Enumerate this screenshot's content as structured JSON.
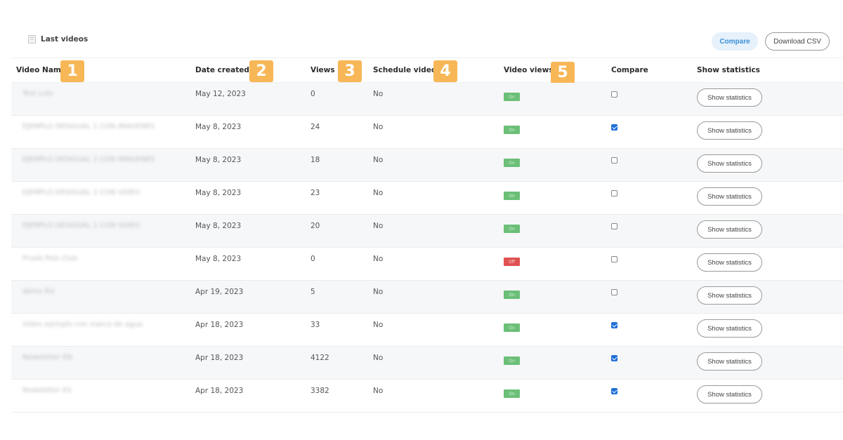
{
  "header": {
    "title": "Last videos",
    "title_icon": "calendar-icon",
    "compare_label": "Compare",
    "download_label": "Download CSV"
  },
  "columns": [
    {
      "label": "Video Name",
      "badge": "1"
    },
    {
      "label": "Date created",
      "badge": "2"
    },
    {
      "label": "Views",
      "badge": "3"
    },
    {
      "label": "Schedule video",
      "badge": "4"
    },
    {
      "label": "Video views",
      "badge": "5"
    },
    {
      "label": "Compare"
    },
    {
      "label": "Show statistics"
    }
  ],
  "accent_colors": {
    "badge": "#f7b757",
    "on": "#6bbf77",
    "off": "#e05252",
    "checkbox": "#1f6fd6",
    "compare_button_bg": "#e6f1fb"
  },
  "rows": [
    {
      "name": "Test Lulo",
      "date": "May 12, 2023",
      "views": "0",
      "schedule": "No",
      "status": "On",
      "compare": false,
      "action": "Show statistics"
    },
    {
      "name": "EJEMPLO DESIGUAL 1 CON IMAGENES",
      "date": "May 8, 2023",
      "views": "24",
      "schedule": "No",
      "status": "On",
      "compare": true,
      "action": "Show statistics"
    },
    {
      "name": "EJEMPLO DESIGUAL 2 CON IMAGENES",
      "date": "May 8, 2023",
      "views": "18",
      "schedule": "No",
      "status": "On",
      "compare": false,
      "action": "Show statistics"
    },
    {
      "name": "EJEMPLO DESIGUAL 2 CON VIDEO",
      "date": "May 8, 2023",
      "views": "23",
      "schedule": "No",
      "status": "On",
      "compare": false,
      "action": "Show statistics"
    },
    {
      "name": "EJEMPLO DESIGUAL 1 CON VIDEO",
      "date": "May 8, 2023",
      "views": "20",
      "schedule": "No",
      "status": "On",
      "compare": false,
      "action": "Show statistics"
    },
    {
      "name": "Prueb Polo Club",
      "date": "May 8, 2023",
      "views": "0",
      "schedule": "No",
      "status": "Off",
      "compare": false,
      "action": "Show statistics"
    },
    {
      "name": "demo Ric",
      "date": "Apr 19, 2023",
      "views": "5",
      "schedule": "No",
      "status": "On",
      "compare": false,
      "action": "Show statistics"
    },
    {
      "name": "Video ejemplo con marca de agua",
      "date": "Apr 18, 2023",
      "views": "33",
      "schedule": "No",
      "status": "On",
      "compare": true,
      "action": "Show statistics"
    },
    {
      "name": "Newsletter EN",
      "date": "Apr 18, 2023",
      "views": "4122",
      "schedule": "No",
      "status": "On",
      "compare": true,
      "action": "Show statistics"
    },
    {
      "name": "Newsletter ES",
      "date": "Apr 18, 2023",
      "views": "3382",
      "schedule": "No",
      "status": "On",
      "compare": true,
      "action": "Show statistics"
    }
  ]
}
